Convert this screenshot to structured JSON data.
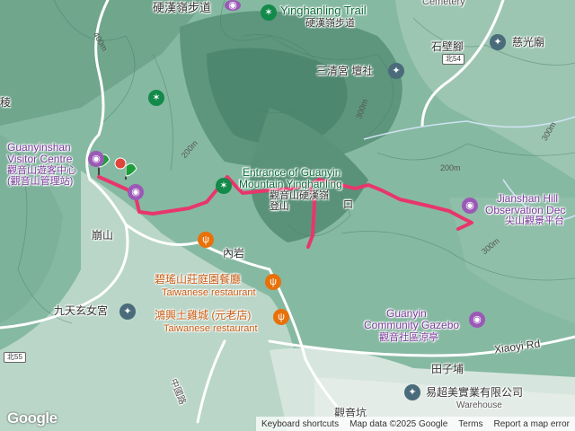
{
  "poi_top": {
    "yingham_trail_cn_top": "硬漢嶺步道",
    "cemetery": "Cemetery"
  },
  "trails": {
    "yinghanling_trail_en": "Yinghanling Trail",
    "yinghanling_trail_cn": "硬漢嶺步道"
  },
  "places": {
    "shibijiao": "石壁腳",
    "cihang_temple": "慈光廟",
    "sanqing_temple": "三清宮 壇社",
    "leng": "稜",
    "guanyinshan_vc_en_1": "Guanyinshan",
    "guanyinshan_vc_en_2": "Visitor Centre",
    "guanyinshan_vc_cn_1": "觀音山遊客中心",
    "guanyinshan_vc_cn_2": "(觀音山管理站)",
    "entrance_en_1": "Entrance of Guanyin",
    "entrance_en_2": "Mountain Yinghanling",
    "entrance_cn_1": "觀音山硬漢嶺",
    "entrance_cn_2": "登山",
    "entrance_cn_3": "口",
    "jianshan_en_1": "Jianshan Hill",
    "jianshan_en_2": "Observation Dec",
    "jianshan_cn": "尖山觀景平台",
    "bengshan": "崩山",
    "neiyan": "內岩",
    "restaurant1_cn": "碧瑤山莊庭園餐廳",
    "restaurant1_en": "Taiwanese restaurant",
    "restaurant2_cn": "鴻興土雞城 (元老店)",
    "restaurant2_en": "Taiwanese restaurant",
    "jiutian_temple": "九天玄女宮",
    "gazebo_en_1": "Guanyin",
    "gazebo_en_2": "Community Gazebo",
    "gazebo_cn": "觀音社區涼亭",
    "xiaoyi_rd": "Xiaoyi Rd",
    "tianzipu": "田子埔",
    "company_cn": "易超美實業有限公司",
    "company_en": "Warehouse",
    "guanyinkeng": "觀音坑",
    "road_vertical": "中國路"
  },
  "elevations": [
    "400m",
    "200m",
    "300m",
    "300m",
    "200m",
    "300m"
  ],
  "road_shields": [
    "北54",
    "北55"
  ],
  "footer": {
    "keyboard_shortcuts": "Keyboard shortcuts",
    "map_data": "Map data ©2025 Google",
    "terms": "Terms",
    "report": "Report a map error"
  },
  "logo": "Google",
  "colors": {
    "route": "#e8366b",
    "trail_icon": "#128a4a",
    "poi_purple": "#9b59b6",
    "poi_orange": "#e8710a",
    "marker_green": "#1e9e3a",
    "marker_red": "#e0453a"
  },
  "icons": {
    "attraction": "camera-icon",
    "trail": "hiker-icon",
    "restaurant": "fork-knife-icon",
    "business": "pin-icon",
    "flag": "flag-marker-icon"
  }
}
